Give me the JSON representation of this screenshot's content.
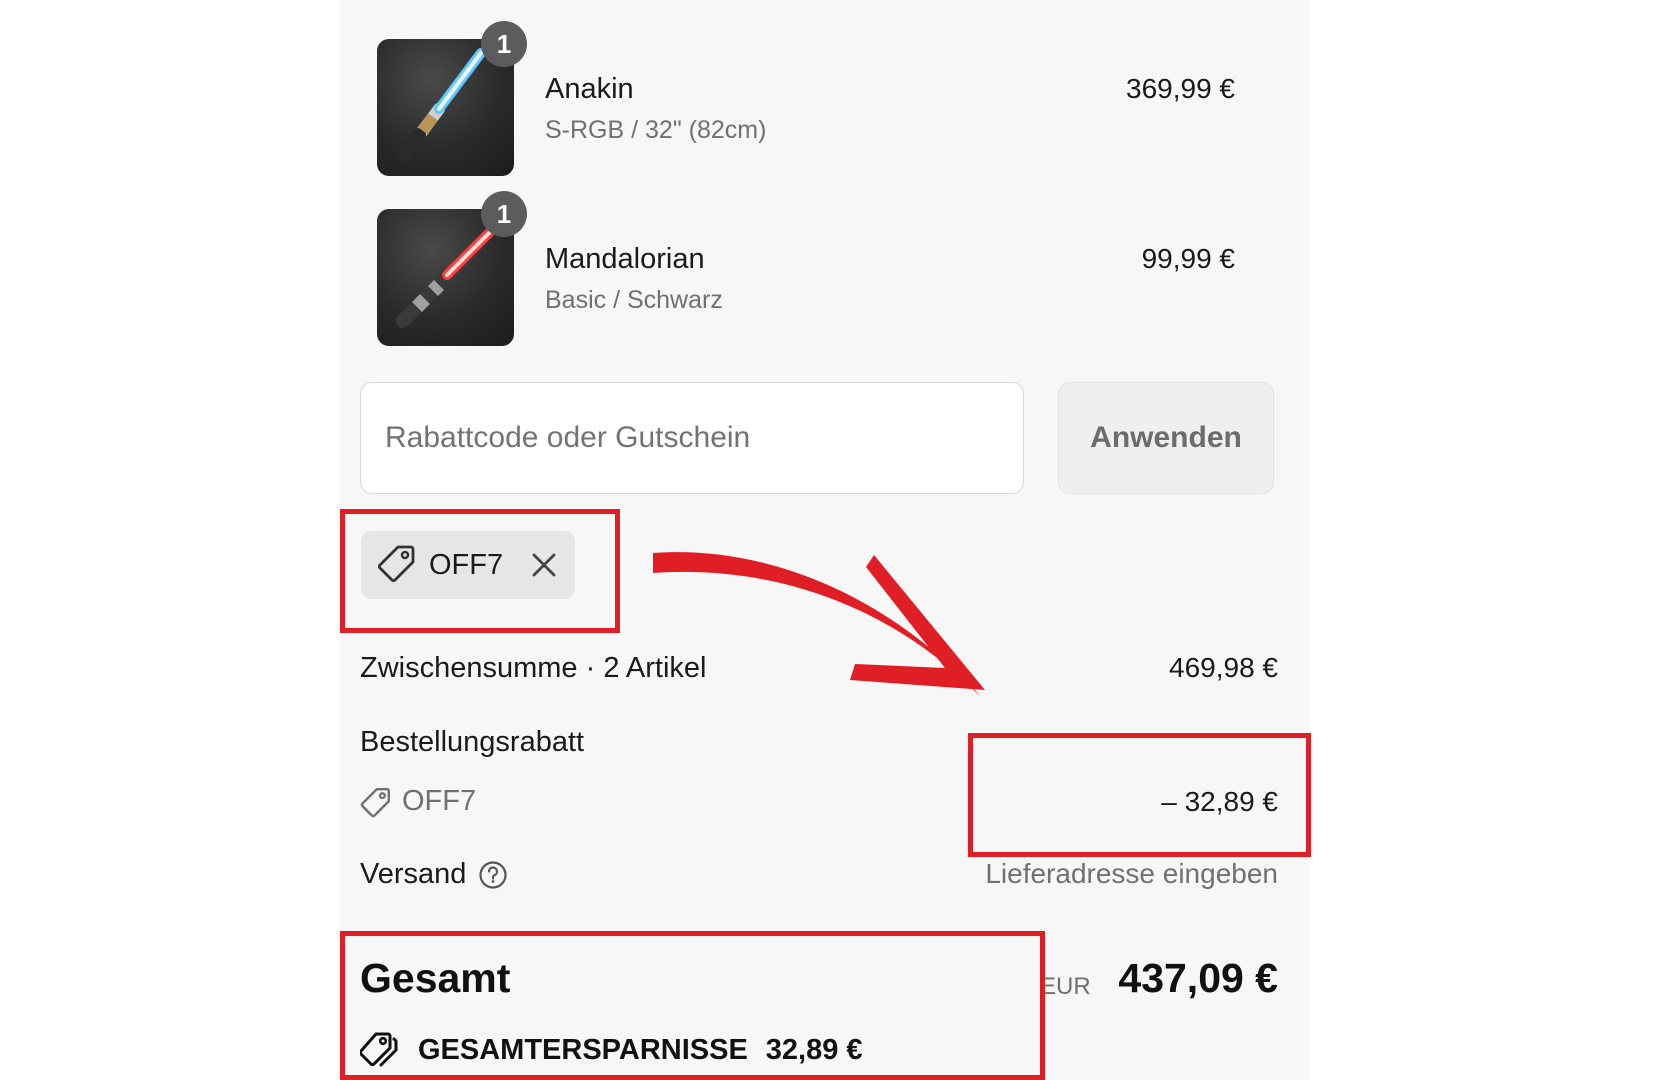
{
  "cart": {
    "items": [
      {
        "quantity": "1",
        "name": "Anakin",
        "variant": "S-RGB / 32\" (82cm)",
        "price": "369,99 €",
        "blade_color": "#5fc8ff"
      },
      {
        "quantity": "1",
        "name": "Mandalorian",
        "variant": "Basic / Schwarz",
        "price": "99,99 €",
        "blade_color": "#ff3b3b"
      }
    ]
  },
  "discount": {
    "placeholder": "Rabattcode oder Gutschein",
    "apply_label": "Anwenden",
    "applied_code": "OFF7"
  },
  "summary": {
    "subtotal_label": "Zwischensumme · 2 Artikel",
    "subtotal_value": "469,98 €",
    "order_discount_label": "Bestellungsrabatt",
    "order_discount_code": "OFF7",
    "order_discount_value": "– 32,89 €",
    "shipping_label": "Versand",
    "shipping_value": "Lieferadresse eingeben",
    "total_label": "Gesamt",
    "currency": "EUR",
    "total_value": "437,09 €",
    "savings_label": "GESAMTERSPARNISSE",
    "savings_value": "32,89 €"
  },
  "annotation": {
    "highlight_color": "#e01e26"
  }
}
